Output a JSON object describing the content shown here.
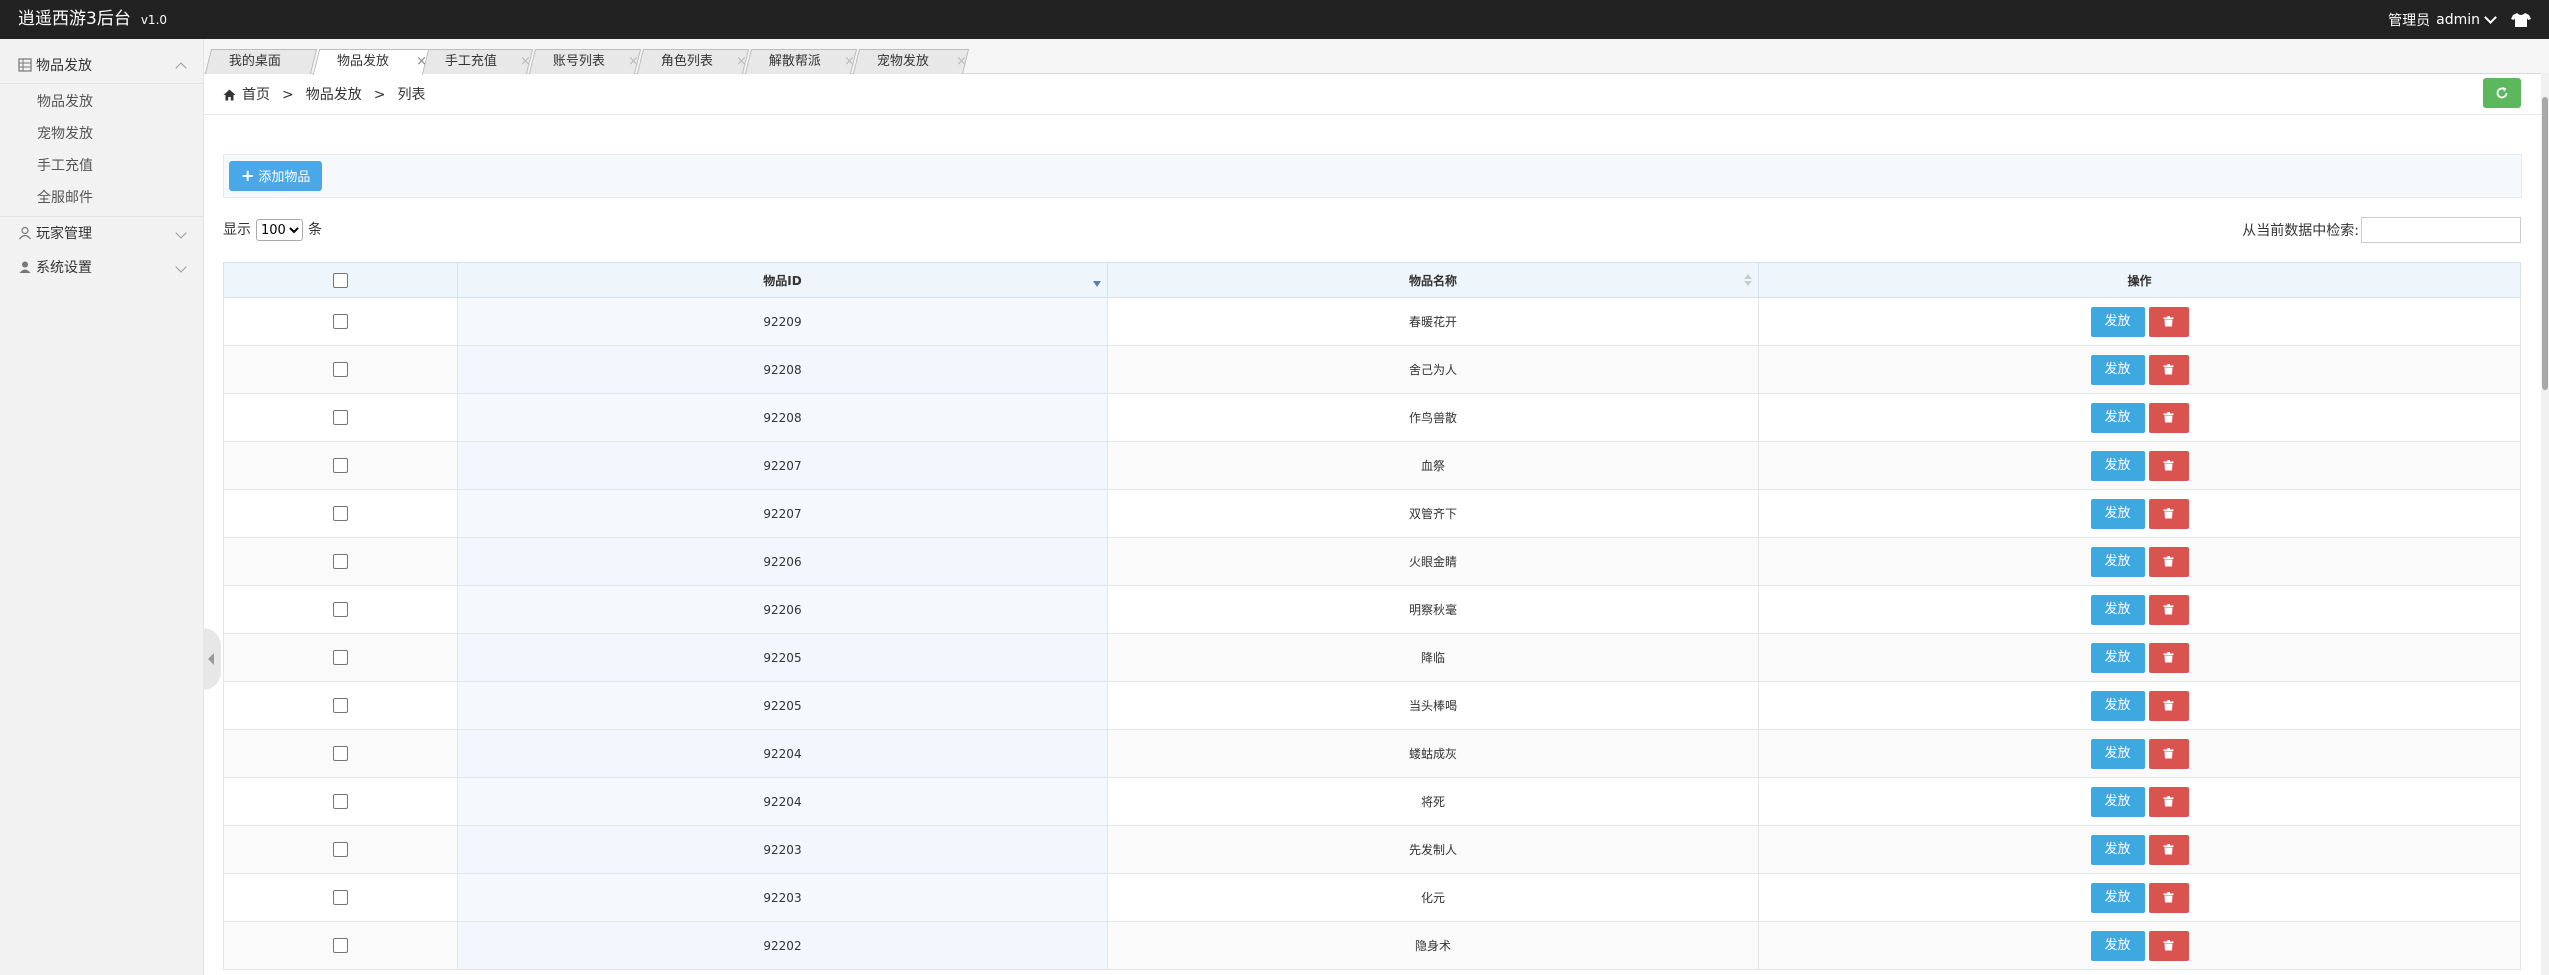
{
  "header": {
    "title": "逍遥西游3后台",
    "version": "v1.0",
    "role_label": "管理员",
    "username": "admin"
  },
  "sidebar": {
    "groups": [
      {
        "label": "物品发放",
        "icon": "grid-icon",
        "expanded": true,
        "items": [
          "物品发放",
          "宠物发放",
          "手工充值",
          "全服邮件"
        ]
      },
      {
        "label": "玩家管理",
        "icon": "user-icon",
        "expanded": false
      },
      {
        "label": "系统设置",
        "icon": "person-icon",
        "expanded": false
      }
    ]
  },
  "tabs": [
    {
      "label": "我的桌面",
      "active": false
    },
    {
      "label": "物品发放",
      "active": true
    },
    {
      "label": "手工充值",
      "active": false
    },
    {
      "label": "账号列表",
      "active": false
    },
    {
      "label": "角色列表",
      "active": false
    },
    {
      "label": "解散帮派",
      "active": false
    },
    {
      "label": "宠物发放",
      "active": false
    }
  ],
  "breadcrumb": {
    "home": "首页",
    "section": "物品发放",
    "page": "列表",
    "separator": ">"
  },
  "toolbar": {
    "add_label": "添加物品",
    "add_symbol": "+"
  },
  "list_controls": {
    "show_prefix": "显示",
    "page_size": "100",
    "show_suffix": "条",
    "search_label": "从当前数据中检索:"
  },
  "table": {
    "columns": [
      "物品ID",
      "物品名称",
      "操作"
    ],
    "send_label": "发放",
    "rows": [
      {
        "id": "92209",
        "name": "春暖花开"
      },
      {
        "id": "92208",
        "name": "舍己为人"
      },
      {
        "id": "92208",
        "name": "作鸟兽散"
      },
      {
        "id": "92207",
        "name": "血祭"
      },
      {
        "id": "92207",
        "name": "双管齐下"
      },
      {
        "id": "92206",
        "name": "火眼金睛"
      },
      {
        "id": "92206",
        "name": "明察秋毫"
      },
      {
        "id": "92205",
        "name": "降临"
      },
      {
        "id": "92205",
        "name": "当头棒喝"
      },
      {
        "id": "92204",
        "name": "蝼蛄成灰"
      },
      {
        "id": "92204",
        "name": "将死"
      },
      {
        "id": "92203",
        "name": "先发制人"
      },
      {
        "id": "92203",
        "name": "化元"
      },
      {
        "id": "92202",
        "name": "隐身术"
      }
    ]
  },
  "colors": {
    "header_bg": "#222222",
    "primary": "#3ea9e0",
    "danger": "#d9534f",
    "success": "#5cb85c"
  }
}
